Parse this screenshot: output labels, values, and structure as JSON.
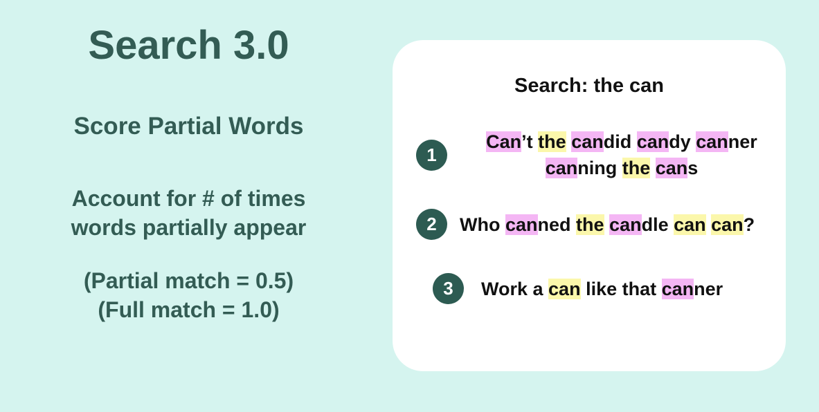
{
  "left": {
    "title": "Search 3.0",
    "subtitle": "Score Partial Words",
    "description": [
      "Account for # of times",
      "words partially appear"
    ],
    "scoring": [
      "(Partial match = 0.5)",
      "(Full match = 1.0)"
    ]
  },
  "card": {
    "search_query": "Search: the can",
    "highlight_colors": {
      "partial": "#f4b6f4",
      "full": "#fbf7ab"
    },
    "badge_color": "#2d5b52",
    "results": [
      {
        "rank": "1",
        "lines": [
          [
            {
              "text": "Can",
              "match": "partial"
            },
            {
              "text": "’t ",
              "match": "none"
            },
            {
              "text": "the",
              "match": "full"
            },
            {
              "text": " ",
              "match": "none"
            },
            {
              "text": "can",
              "match": "partial"
            },
            {
              "text": "did ",
              "match": "none"
            },
            {
              "text": "can",
              "match": "partial"
            },
            {
              "text": "dy ",
              "match": "none"
            },
            {
              "text": "can",
              "match": "partial"
            },
            {
              "text": "ner",
              "match": "none"
            }
          ],
          [
            {
              "text": "can",
              "match": "partial"
            },
            {
              "text": "ning ",
              "match": "none"
            },
            {
              "text": "the",
              "match": "full"
            },
            {
              "text": " ",
              "match": "none"
            },
            {
              "text": "can",
              "match": "partial"
            },
            {
              "text": "s",
              "match": "none"
            }
          ]
        ]
      },
      {
        "rank": "2",
        "lines": [
          [
            {
              "text": "Who ",
              "match": "none"
            },
            {
              "text": "can",
              "match": "partial"
            },
            {
              "text": "ned ",
              "match": "none"
            },
            {
              "text": "the",
              "match": "full"
            },
            {
              "text": " ",
              "match": "none"
            },
            {
              "text": "can",
              "match": "partial"
            },
            {
              "text": "dle ",
              "match": "none"
            },
            {
              "text": "can",
              "match": "full"
            },
            {
              "text": " ",
              "match": "none"
            },
            {
              "text": "can",
              "match": "full"
            },
            {
              "text": "?",
              "match": "none"
            }
          ]
        ]
      },
      {
        "rank": "3",
        "lines": [
          [
            {
              "text": "Work a ",
              "match": "none"
            },
            {
              "text": "can",
              "match": "full"
            },
            {
              "text": " like that ",
              "match": "none"
            },
            {
              "text": "can",
              "match": "partial"
            },
            {
              "text": "ner",
              "match": "none"
            }
          ]
        ]
      }
    ]
  }
}
